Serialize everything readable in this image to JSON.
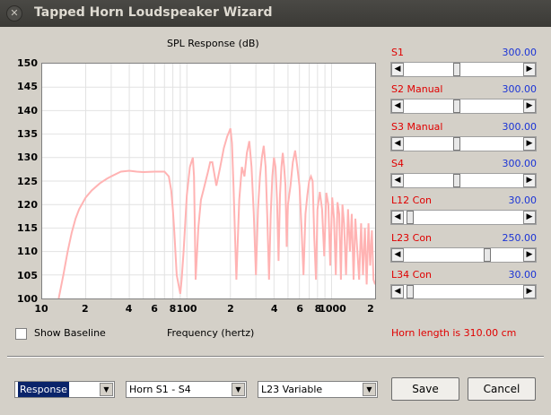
{
  "window": {
    "title": "Tapped Horn Loudspeaker Wizard",
    "close_glyph": "✕"
  },
  "chart_data": {
    "type": "line",
    "title": "SPL Response (dB)",
    "xlabel": "Frequency (hertz)",
    "ylabel": "",
    "x_scale": "log",
    "xlim": [
      10,
      2000
    ],
    "ylim": [
      100,
      150
    ],
    "y_ticks": [
      "150",
      "145",
      "140",
      "135",
      "130",
      "125",
      "120",
      "115",
      "110",
      "105",
      "100"
    ],
    "x_ticks": [
      "10",
      "2",
      "4",
      "6",
      "8",
      "100",
      "2",
      "4",
      "6",
      "8",
      "1000",
      "2"
    ],
    "grid": true,
    "line_color": "#ffb3b3",
    "series": [
      {
        "x": [
          13,
          14,
          15,
          16,
          17,
          18,
          20,
          22,
          25,
          28,
          30,
          35,
          40,
          45,
          50,
          60,
          70,
          75,
          78,
          80,
          82,
          85,
          90,
          92,
          95,
          100,
          105,
          110,
          112,
          115,
          120,
          125,
          130,
          135,
          140,
          145,
          150,
          160,
          170,
          180,
          190,
          200,
          205,
          210,
          220,
          230,
          240,
          250,
          260,
          270,
          280,
          290,
          300,
          310,
          320,
          330,
          340,
          350,
          360,
          370,
          380,
          390,
          400,
          410,
          420,
          430,
          440,
          450,
          460,
          470,
          480,
          490,
          500,
          520,
          540,
          560,
          580,
          600,
          620,
          640,
          660,
          680,
          700,
          720,
          740,
          760,
          780,
          800,
          830,
          860,
          890,
          920,
          950,
          980,
          1010,
          1040,
          1070,
          1100,
          1130,
          1160,
          1190,
          1220,
          1260,
          1300,
          1340,
          1380,
          1420,
          1460,
          1500,
          1550,
          1600,
          1650,
          1700,
          1750,
          1800,
          1850,
          1900,
          1950,
          2000
        ],
        "y": [
          100,
          105,
          110,
          114,
          117,
          119,
          121.5,
          123,
          124.5,
          125.5,
          126,
          127,
          127.2,
          127,
          126.9,
          127,
          127,
          126,
          123,
          119,
          114,
          105,
          101,
          104,
          110,
          122,
          128,
          130,
          126,
          104,
          115,
          121,
          123,
          125,
          127,
          129,
          129,
          124,
          128,
          132,
          134.5,
          136.2,
          133,
          124,
          104,
          121,
          128,
          126,
          131,
          133.5,
          128,
          118,
          105,
          119,
          126,
          130,
          132.5,
          128,
          117,
          104,
          118,
          126,
          130,
          128,
          121,
          108,
          122,
          128,
          131,
          128,
          124,
          111,
          120,
          124,
          129,
          131.5,
          128,
          124,
          115,
          105,
          118,
          122,
          125,
          126,
          125,
          113,
          104,
          119,
          122.7,
          119,
          109,
          122.5,
          120,
          107,
          121.5,
          117,
          105,
          120.5,
          118,
          104,
          120,
          116,
          105,
          119,
          110,
          118,
          104,
          117,
          111,
          104,
          116,
          105,
          115,
          103,
          116,
          107,
          114.5,
          104,
          103
        ]
      }
    ]
  },
  "baseline": {
    "label": "Show Baseline",
    "checked": false
  },
  "sliders": [
    {
      "name": "S1",
      "mode": "",
      "value": "300.00",
      "position": 0.44
    },
    {
      "name": "S2",
      "mode": "Manual",
      "value": "300.00",
      "position": 0.44
    },
    {
      "name": "S3",
      "mode": "Manual",
      "value": "300.00",
      "position": 0.44
    },
    {
      "name": "S4",
      "mode": "",
      "value": "300.00",
      "position": 0.44
    },
    {
      "name": "L12",
      "mode": "Con",
      "value": "30.00",
      "position": 0.02
    },
    {
      "name": "L23",
      "mode": "Con",
      "value": "250.00",
      "position": 0.71
    },
    {
      "name": "L34",
      "mode": "Con",
      "value": "30.00",
      "position": 0.02
    }
  ],
  "slider_left_arrow": "◀",
  "slider_right_arrow": "▶",
  "horn_length": "Horn length is 310.00 cm",
  "combos": [
    {
      "value": "Response",
      "arrow": "▼"
    },
    {
      "value": "Horn S1 - S4",
      "arrow": "▼"
    },
    {
      "value": "L23 Variable",
      "arrow": "▼"
    }
  ],
  "buttons": {
    "save": "Save",
    "cancel": "Cancel"
  }
}
